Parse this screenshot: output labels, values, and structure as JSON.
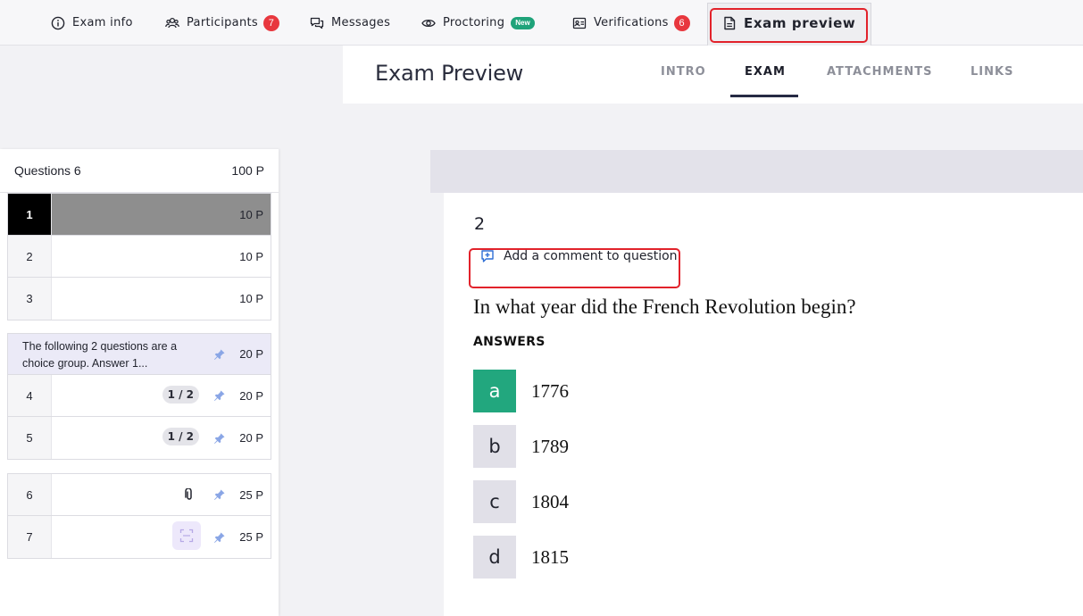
{
  "nav": {
    "items": [
      {
        "label": "Exam info",
        "icon": "info-icon"
      },
      {
        "label": "Participants",
        "icon": "users-icon",
        "badge": "7"
      },
      {
        "label": "Messages",
        "icon": "messages-icon"
      },
      {
        "label": "Proctoring",
        "icon": "eye-icon",
        "badge_new": "New"
      },
      {
        "label": "Verifications",
        "icon": "id-card-icon",
        "badge": "6"
      },
      {
        "label": "Exam preview",
        "icon": "document-icon",
        "active": true
      }
    ]
  },
  "preview": {
    "title": "Exam Preview",
    "tabs": [
      "INTRO",
      "EXAM",
      "ATTACHMENTS",
      "LINKS"
    ],
    "active_tab": "EXAM"
  },
  "sidebar": {
    "header_label": "Questions 6",
    "header_points": "100 P",
    "questions": [
      {
        "num": "1",
        "points": "10 P",
        "selected": true
      },
      {
        "num": "2",
        "points": "10 P"
      },
      {
        "num": "3",
        "points": "10 P"
      }
    ],
    "choice_group": {
      "text": "The following 2 questions are a choice group. Answer 1...",
      "points": "20 P",
      "questions": [
        {
          "num": "4",
          "fraction": "1 / 2",
          "points": "20 P"
        },
        {
          "num": "5",
          "fraction": "1 / 2",
          "points": "20 P"
        }
      ]
    },
    "extra_questions": [
      {
        "num": "6",
        "points": "25 P",
        "icon": "paperclip-icon"
      },
      {
        "num": "7",
        "points": "25 P",
        "icon": "scan-icon"
      }
    ]
  },
  "question": {
    "number": "2",
    "comment_label": "Add a comment to question",
    "text": "In what year did the French Revolution begin?",
    "answers_label": "ANSWERS",
    "answers": [
      {
        "letter": "a",
        "text": "1776",
        "correct": true
      },
      {
        "letter": "b",
        "text": "1789"
      },
      {
        "letter": "c",
        "text": "1804"
      },
      {
        "letter": "d",
        "text": "1815"
      }
    ]
  },
  "colors": {
    "accent_red": "#e8373e",
    "highlight_red": "#e2222b",
    "new_badge_green": "#1fa37a",
    "correct_green": "#22a77e",
    "tab_underline": "#262a44"
  }
}
